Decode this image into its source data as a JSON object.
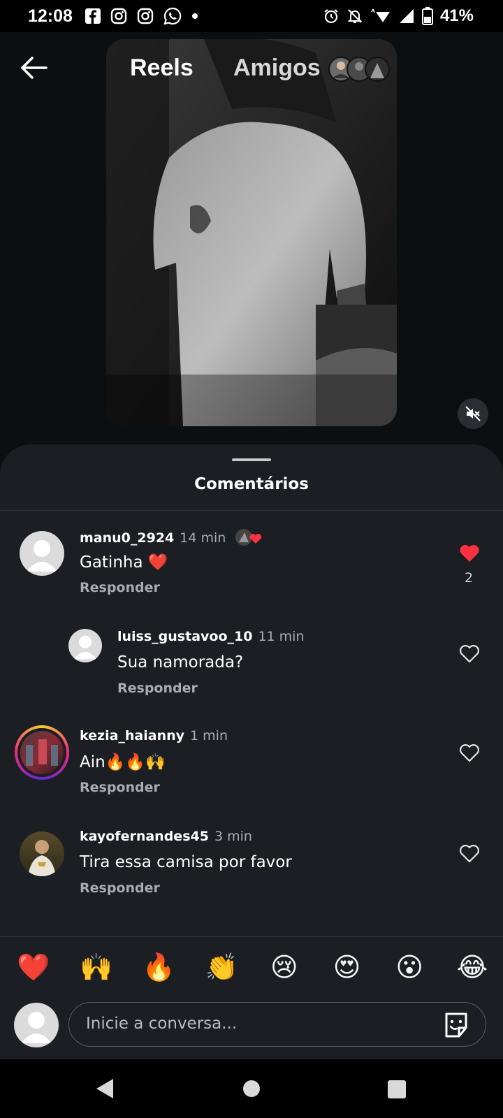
{
  "status_bar": {
    "time": "12:08",
    "left_icons": [
      "facebook-icon",
      "instagram-icon",
      "instagram-icon",
      "whatsapp-icon",
      "dot-icon"
    ],
    "right_icons": [
      "alarm-icon",
      "notifications-off-icon",
      "wifi-icon",
      "signal-icon",
      "battery-icon"
    ],
    "battery": "41%"
  },
  "header": {
    "tab_reels": "Reels",
    "tab_friends": "Amigos"
  },
  "comments_sheet": {
    "title": "Comentários",
    "comments": [
      {
        "user": "manu0_2924",
        "time": "14 min",
        "text": "Gatinha ❤️",
        "reply": "Responder",
        "liked": true,
        "likes": "2"
      },
      {
        "user": "luiss_gustavoo_10",
        "time": "11 min",
        "text": "Sua namorada?",
        "reply": "Responder",
        "liked": false
      },
      {
        "user": "kezia_haianny",
        "time": "1 min",
        "text": "Ain🔥🔥🙌",
        "reply": "Responder",
        "liked": false
      },
      {
        "user": "kayofernandes45",
        "time": "3 min",
        "text": "Tira essa camisa por favor",
        "reply": "Responder",
        "liked": false
      }
    ]
  },
  "quick_reactions": [
    "❤️",
    "🙌",
    "🔥",
    "👏",
    "😢",
    "😍",
    "😮",
    "😂"
  ],
  "composer": {
    "placeholder": "Inicie a conversa..."
  },
  "colors": {
    "like_red": "#ff3040",
    "sheet_bg": "#1b1e22",
    "story_ring": [
      "#f9ce34",
      "#ee2a7b",
      "#6228d7"
    ]
  }
}
